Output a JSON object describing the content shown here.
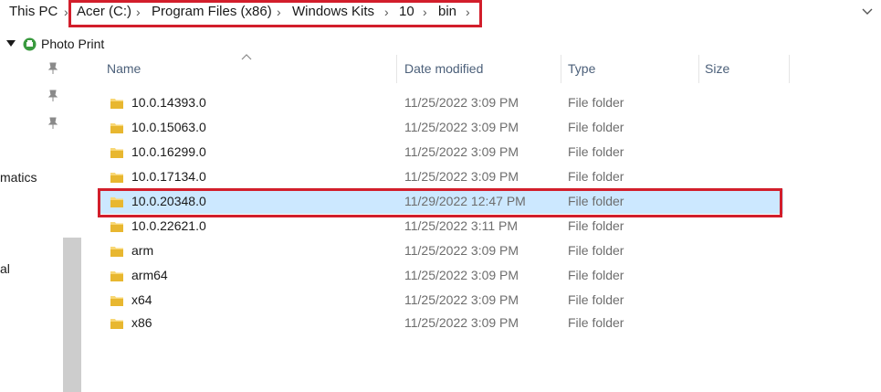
{
  "address_bar": {
    "this_pc": "This PC",
    "crumbs": [
      "Acer (C:)",
      "Program Files (x86)",
      "Windows Kits",
      "10",
      "bin"
    ]
  },
  "quick_access": {
    "label": "Photo Print"
  },
  "nav_pane": {
    "item_1": "matics",
    "item_2": "al"
  },
  "columns": {
    "name": "Name",
    "date": "Date modified",
    "type": "Type",
    "size": "Size"
  },
  "files": [
    {
      "name": "10.0.14393.0",
      "date": "11/25/2022 3:09 PM",
      "type": "File folder"
    },
    {
      "name": "10.0.15063.0",
      "date": "11/25/2022 3:09 PM",
      "type": "File folder"
    },
    {
      "name": "10.0.16299.0",
      "date": "11/25/2022 3:09 PM",
      "type": "File folder"
    },
    {
      "name": "10.0.17134.0",
      "date": "11/25/2022 3:09 PM",
      "type": "File folder"
    },
    {
      "name": "10.0.20348.0",
      "date": "11/29/2022 12:47 PM",
      "type": "File folder",
      "selected": true
    },
    {
      "name": "10.0.22621.0",
      "date": "11/25/2022 3:11 PM",
      "type": "File folder"
    },
    {
      "name": "arm",
      "date": "11/25/2022 3:09 PM",
      "type": "File folder"
    },
    {
      "name": "arm64",
      "date": "11/25/2022 3:09 PM",
      "type": "File folder"
    },
    {
      "name": "x64",
      "date": "11/25/2022 3:09 PM",
      "type": "File folder"
    },
    {
      "name": "x86",
      "date": "11/25/2022 3:09 PM",
      "type": "File folder"
    }
  ],
  "colors": {
    "highlight_box": "#d21e2b",
    "selection": "#cce8ff",
    "folder": "#f8d775"
  }
}
